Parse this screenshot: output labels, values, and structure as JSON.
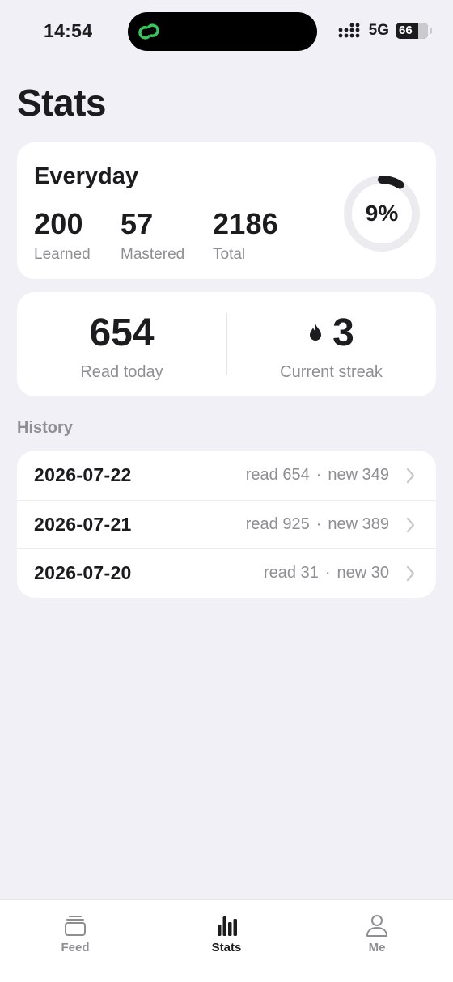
{
  "status": {
    "time": "14:54",
    "network": "5G",
    "battery": "66"
  },
  "page": {
    "title": "Stats"
  },
  "deck": {
    "name": "Everyday",
    "learned_value": "200",
    "learned_label": "Learned",
    "mastered_value": "57",
    "mastered_label": "Mastered",
    "total_value": "2186",
    "total_label": "Total",
    "progress_text": "9%",
    "progress_fraction": 0.09
  },
  "today": {
    "read_value": "654",
    "read_label": "Read today",
    "streak_value": "3",
    "streak_label": "Current streak"
  },
  "history": {
    "label": "History",
    "rows": [
      {
        "date": "2026-07-22",
        "read": "read 654",
        "sep": "·",
        "new": "new 349"
      },
      {
        "date": "2026-07-21",
        "read": "read 925",
        "sep": "·",
        "new": "new 389"
      },
      {
        "date": "2026-07-20",
        "read": "read 31",
        "sep": "·",
        "new": "new 30"
      }
    ]
  },
  "tabs": [
    {
      "label": "Feed",
      "icon": "stack-icon",
      "active": false
    },
    {
      "label": "Stats",
      "icon": "bar-chart-icon",
      "active": true
    },
    {
      "label": "Me",
      "icon": "person-icon",
      "active": false
    }
  ],
  "colors": {
    "background": "#F1F0F6",
    "card": "#FFFFFF",
    "text": "#1C1C1E",
    "secondary_text": "#8E8E93",
    "island_icon": "#34C759"
  }
}
